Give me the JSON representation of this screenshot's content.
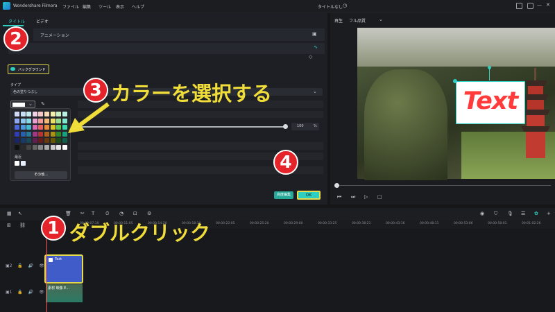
{
  "app": {
    "name": "Wondershare Filmora",
    "project_title": "タイトルなし"
  },
  "menu": [
    "ファイル",
    "編集",
    "ツール",
    "表示",
    "ヘルプ"
  ],
  "left_panel": {
    "tabs": [
      "タイトル",
      "ビデオ"
    ],
    "animation_tab": "アニメーション",
    "background_label": "バックグラウンド",
    "type_label": "タイプ",
    "type_value": "色の塗りつぶし",
    "opacity_value": "100",
    "opacity_unit": "%",
    "recent_label": "最近",
    "other_button": "その他...",
    "advanced_button": "高度編集",
    "ok_button": "OK"
  },
  "preview": {
    "label": "再生",
    "quality": "フル品質",
    "overlay_text": "Text"
  },
  "timeline": {
    "ticks": [
      "00:00:03:20",
      "00:00:07:10",
      "00:00:11:05",
      "00:00:14:20",
      "00:00:18:10",
      "00:00:22:05",
      "00:00:25:20",
      "00:00:29:00",
      "00:00:33:25",
      "00:00:38:21",
      "00:00:43:16",
      "00:00:48:11",
      "00:00:53:06",
      "00:00:58:01",
      "00:01:02:26",
      "00:01:07:22"
    ],
    "text_clip_label": "Text",
    "video_clip_label": "素材 映像 E..."
  },
  "annotations": [
    {
      "number": "1",
      "text": "ダブルクリック"
    },
    {
      "number": "2",
      "text": ""
    },
    {
      "number": "3",
      "text": "カラーを選択する"
    },
    {
      "number": "4",
      "text": ""
    }
  ],
  "colors": {
    "accent": "#2ecfc1",
    "highlight": "#e7dc4b",
    "badge": "#e5232a"
  }
}
